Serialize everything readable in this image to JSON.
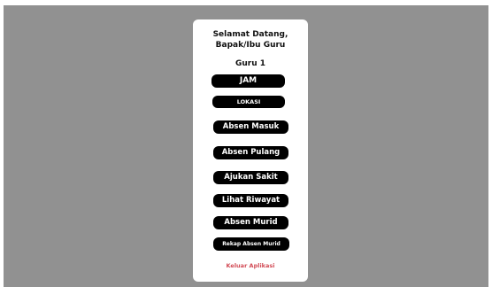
{
  "colors": {
    "backdrop": "#919191",
    "card": "#ffffff",
    "button_bg": "#000000",
    "button_text": "#ffffff",
    "exit_link": "#d24b55"
  },
  "greeting": {
    "line1": "Selamat Datang,",
    "line2": "Bapak/Ibu Guru"
  },
  "user": {
    "name": "Guru 1"
  },
  "menu": {
    "jam": "JAM",
    "lokasi": "LOKASI",
    "absen_masuk": "Absen Masuk",
    "absen_pulang": "Absen Pulang",
    "ajukan_sakit": "Ajukan Sakit",
    "lihat_riwayat": "Lihat Riwayat",
    "absen_murid": "Absen Murid",
    "rekap_absen_murid": "Rekap Absen Murid"
  },
  "exit": {
    "label": "Keluar Aplikasi"
  }
}
